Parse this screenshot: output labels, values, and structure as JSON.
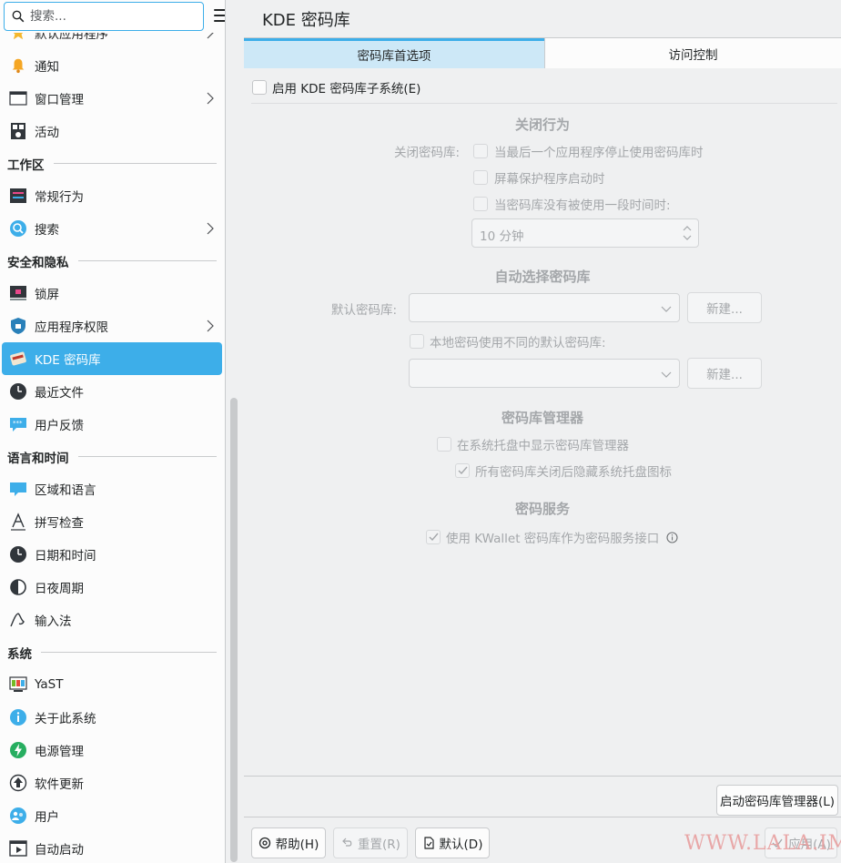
{
  "search": {
    "placeholder": "搜索..."
  },
  "sidebar": {
    "items": [
      {
        "label": "默认应用程序",
        "icon": "star-icon",
        "section": ""
      },
      {
        "label": "通知",
        "icon": "bell-icon"
      },
      {
        "label": "窗口管理",
        "icon": "window-icon"
      },
      {
        "label": "活动",
        "icon": "activities-icon"
      },
      {
        "label": "常规行为",
        "icon": "general-behavior-icon"
      },
      {
        "label": "搜索",
        "icon": "search-icon"
      },
      {
        "label": "锁屏",
        "icon": "lock-screen-icon"
      },
      {
        "label": "应用程序权限",
        "icon": "shield-icon"
      },
      {
        "label": "KDE 密码库",
        "icon": "wallet-icon"
      },
      {
        "label": "最近文件",
        "icon": "clock-icon"
      },
      {
        "label": "用户反馈",
        "icon": "feedback-icon"
      },
      {
        "label": "区域和语言",
        "icon": "locale-icon"
      },
      {
        "label": "拼写检查",
        "icon": "spellcheck-icon"
      },
      {
        "label": "日期和时间",
        "icon": "clock-icon"
      },
      {
        "label": "日夜周期",
        "icon": "day-night-icon"
      },
      {
        "label": "输入法",
        "icon": "input-method-icon"
      },
      {
        "label": "YaST",
        "icon": "yast-icon"
      },
      {
        "label": "关于此系统",
        "icon": "info-icon"
      },
      {
        "label": "电源管理",
        "icon": "power-icon"
      },
      {
        "label": "软件更新",
        "icon": "update-icon"
      },
      {
        "label": "用户",
        "icon": "users-icon"
      },
      {
        "label": "自动启动",
        "icon": "autostart-icon"
      }
    ],
    "sections": {
      "workspace": "工作区",
      "security": "安全和隐私",
      "language": "语言和时间",
      "system": "系统"
    }
  },
  "header": {
    "title": "KDE 密码库"
  },
  "tabs": {
    "prefs": "密码库首选项",
    "access": "访问控制"
  },
  "main": {
    "enable": "启用 KDE 密码库子系统(E)",
    "close": {
      "header": "关闭行为",
      "label": "关闭密码库:",
      "opt1": "当最后一个应用程序停止使用密码库时",
      "opt2": "屏幕保护程序启动时",
      "opt3": "当密码库没有被使用一段时间时:",
      "spin": "10 分钟"
    },
    "auto": {
      "header": "自动选择密码库",
      "default_label": "默认密码库:",
      "new1": "新建...",
      "local": "本地密码使用不同的默认密码库:",
      "new2": "新建..."
    },
    "manager": {
      "header": "密码库管理器",
      "opt1": "在系统托盘中显示密码库管理器",
      "opt2": "所有密码库关闭后隐藏系统托盘图标"
    },
    "service": {
      "header": "密码服务",
      "opt1": "使用 KWallet 密码库作为密码服务接口"
    },
    "launch": "启动密码库管理器(L)"
  },
  "footer": {
    "help": "帮助(H)",
    "reset": "重置(R)",
    "defaults": "默认(D)",
    "apply": "应用(A)"
  },
  "watermark": "WWW.LALA.IM",
  "colors": {
    "accent": "#3daee9",
    "tab_active_bg": "#cde8f7"
  }
}
